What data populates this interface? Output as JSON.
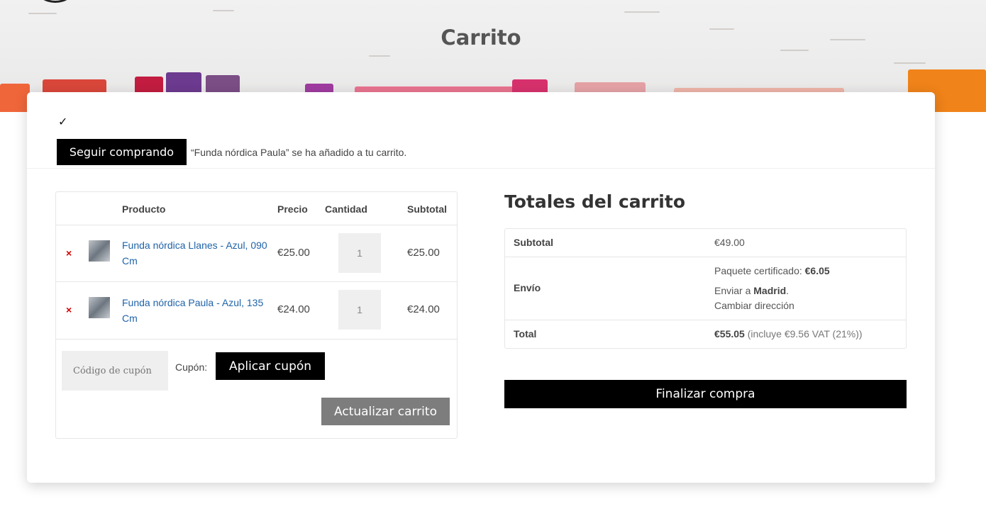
{
  "page": {
    "title": "Carrito"
  },
  "notice": {
    "check_glyph": "✓",
    "continue_label": "Seguir comprando",
    "message": "“Funda nórdica Paula” se ha añadido a tu carrito."
  },
  "cart": {
    "headers": {
      "product": "Producto",
      "price": "Precio",
      "quantity": "Cantidad",
      "subtotal": "Subtotal"
    },
    "items": [
      {
        "remove": "×",
        "name": "Funda nórdica Llanes - Azul, 090 Cm",
        "price": "€25.00",
        "quantity": "1",
        "subtotal": "€25.00"
      },
      {
        "remove": "×",
        "name": "Funda nórdica Paula - Azul, 135 Cm",
        "price": "€24.00",
        "quantity": "1",
        "subtotal": "€24.00"
      }
    ],
    "coupon_placeholder": "Código de cupón",
    "coupon_label": "Cupón:",
    "apply_label": "Aplicar cupón",
    "update_label": "Actualizar carrito"
  },
  "totals": {
    "title": "Totales del carrito",
    "subtotal_label": "Subtotal",
    "subtotal_value": "€49.00",
    "shipping_label": "Envío",
    "shipping_method": "Paquete certificado:",
    "shipping_cost": "€6.05",
    "ship_to_prefix": "Enviar a",
    "ship_to_city": "Madrid",
    "ship_to_suffix": ".",
    "change_address": "Cambiar dirección",
    "total_label": "Total",
    "total_value": "€55.05",
    "total_note": "(incluye €9.56 VAT (21%))",
    "checkout_label": "Finalizar compra"
  },
  "colors": {
    "link": "#1f63a8",
    "remove": "#d10000",
    "primary_button": "#000000",
    "secondary_button": "#7d7d7d"
  }
}
